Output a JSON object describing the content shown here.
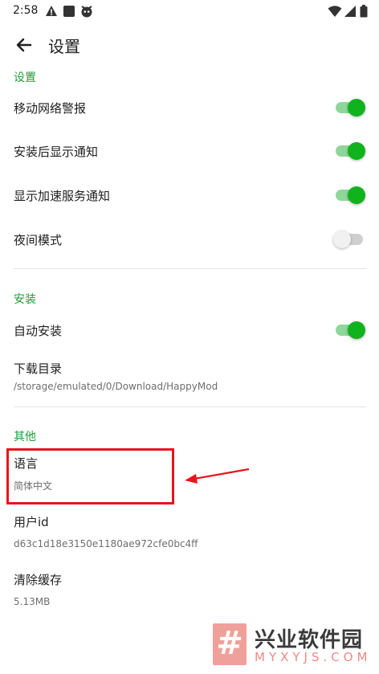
{
  "status_bar": {
    "time": "2:58"
  },
  "app_bar": {
    "title": "设置"
  },
  "sections": {
    "settings": {
      "header": "设置",
      "mobile_warning": {
        "label": "移动网络警报",
        "on": true
      },
      "notify_after_install": {
        "label": "安装后显示通知",
        "on": true
      },
      "notify_accel": {
        "label": "显示加速服务通知",
        "on": true
      },
      "night_mode": {
        "label": "夜间模式",
        "on": false
      }
    },
    "install": {
      "header": "安装",
      "auto_install": {
        "label": "自动安装",
        "on": true
      },
      "download_dir": {
        "label": "下载目录",
        "value": "/storage/emulated/0/Download/HappyMod"
      }
    },
    "other": {
      "header": "其他",
      "language": {
        "label": "语言",
        "value": "简体中文"
      },
      "user_id": {
        "label": "用户id",
        "value": "d63c1d18e3150e1180ae972cfe0bc4ff"
      },
      "clear_cache": {
        "label": "清除缓存",
        "value": "5.13MB"
      }
    }
  },
  "colors": {
    "accent": "#1e9c3a",
    "switch_on": "#10b31c",
    "annotation": "#e8141c"
  },
  "watermark": {
    "badge": "#",
    "title": "兴业软件园",
    "url": "MYXYJS.COM"
  }
}
